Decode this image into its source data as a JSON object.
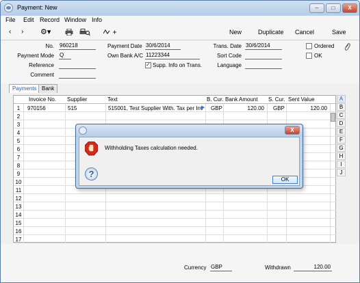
{
  "window": {
    "title": "Payment: New",
    "controls": {
      "minimize": "–",
      "maximize": "□",
      "close": "X"
    }
  },
  "menu": [
    "File",
    "Edit",
    "Record",
    "Window",
    "Info"
  ],
  "toolbar": {
    "new_label": "New",
    "duplicate_label": "Duplicate",
    "cancel_label": "Cancel",
    "save_label": "Save"
  },
  "header": {
    "no_label": "No.",
    "no_value": "960218",
    "payment_mode_label": "Payment Mode",
    "payment_mode_value": "Q",
    "reference_label": "Reference",
    "reference_value": "",
    "comment_label": "Comment",
    "comment_value": "",
    "payment_date_label": "Payment Date",
    "payment_date_value": "30/6/2014",
    "own_bank_label": "Own Bank A/C",
    "own_bank_value": "11223344",
    "supp_info_label": "Supp. Info on Trans.",
    "supp_info_checked": true,
    "trans_date_label": "Trans. Date",
    "trans_date_value": "30/6/2014",
    "sort_code_label": "Sort Code",
    "sort_code_value": "",
    "language_label": "Language",
    "language_value": "",
    "ordered_label": "Ordered",
    "ok_label": "OK"
  },
  "tabs": [
    "Payments",
    "Bank"
  ],
  "grid": {
    "columns": [
      "Invoice No.",
      "Supplier",
      "Text",
      "B. Cur.",
      "Bank Amount",
      "S. Cur.",
      "Sent Value"
    ],
    "rows": [
      {
        "num": "1",
        "invoice": "970156",
        "supplier": "515",
        "text": "515001, Test Supplier With. Tax per Inv",
        "bcur": "GBP",
        "bank_amount": "120.00",
        "scur": "GBP",
        "sent_value": "120.00"
      }
    ],
    "row_numbers": [
      "1",
      "2",
      "3",
      "4",
      "5",
      "6",
      "7",
      "8",
      "9",
      "10",
      "11",
      "12",
      "13",
      "14",
      "15",
      "16",
      "17"
    ]
  },
  "side_letters": [
    "A",
    "B",
    "C",
    "D",
    "E",
    "F",
    "G",
    "H",
    "I",
    "J"
  ],
  "footer": {
    "currency_label": "Currency",
    "currency_value": "GBP",
    "withdrawn_label": "Withdrawn",
    "withdrawn_value": "120.00"
  },
  "dialog": {
    "message": "Withholding Taxes calculation needed.",
    "ok_label": "OK",
    "close_label": "X"
  }
}
